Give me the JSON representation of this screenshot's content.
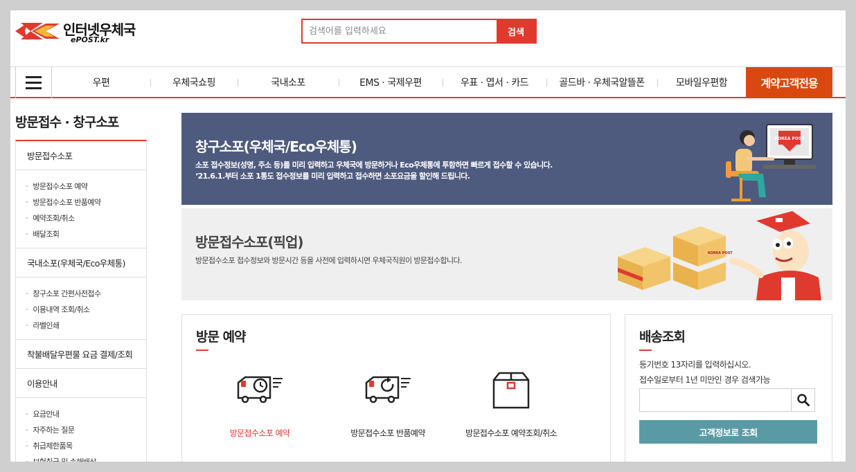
{
  "header": {
    "logo_text": "인터넷우체국",
    "logo_sub": "ePOST.kr",
    "search_placeholder": "검색어를 입력하세요",
    "search_button": "검색"
  },
  "gnb": {
    "items": [
      "우편",
      "우체국쇼핑",
      "국내소포",
      "EMS · 국제우편",
      "우표 · 엽서 · 카드",
      "골드바 · 우체국알뜰폰",
      "모바일우편함"
    ],
    "cta": "계약고객전용"
  },
  "sidebar": {
    "title": "방문접수 · 창구소포",
    "sections": [
      {
        "heading": "방문접수소포",
        "items": [
          "방문접수소포 예약",
          "방문접수소포 반품예약",
          "예약조회/취소",
          "배달조회"
        ]
      },
      {
        "heading": "국내소포(우체국/Eco우체통)",
        "items": [
          "창구소포 간편사전접수",
          "이용내역 조회/취소",
          "라벨인쇄"
        ]
      },
      {
        "heading": "착불배달우편물 요금 결제/조회",
        "items": []
      },
      {
        "heading": "이용안내",
        "items": [
          "요금안내",
          "자주하는 질문",
          "취급제한품목",
          "보험취급 및 손해배상"
        ]
      }
    ]
  },
  "banner1": {
    "title": "창구소포(우체국/Eco우체통)",
    "desc1": "소포 접수정보(성명, 주소 등)를 미리 입력하고 우체국에 방문하거나 Eco우체통에 투함하면 빠르게 접수할 수 있습니다.",
    "desc2": "‘21.6.1.부터 소포 1통도 접수정보를 미리 입력하고 접수하면 소포요금을 할인해 드립니다.",
    "monitor_text": "KOREA POST"
  },
  "banner2": {
    "title": "방문접수소포(픽업)",
    "desc1": "방문접수소포 접수정보와 방문시간 등을 사전에 입력하시면 우체국직원이 방문접수합니다.",
    "box_label": "KOREA POST"
  },
  "visit": {
    "title": "방문 예약",
    "actions": [
      {
        "label": "방문접수소포 예약",
        "icon": "truck-clock-icon",
        "active": true
      },
      {
        "label": "방문접수소포 반품예약",
        "icon": "truck-return-icon",
        "active": false
      },
      {
        "label": "방문접수소포 예약조회/취소",
        "icon": "package-box-icon",
        "active": false
      }
    ]
  },
  "tracking": {
    "title": "배송조회",
    "desc1": "등기번호 13자리를 입력하십시오.",
    "desc2": "접수일로부터 1년 미만인 경우 검색가능",
    "input_placeholder": "",
    "button": "고객정보로 조회"
  },
  "colors": {
    "brand_red": "#e03a2f",
    "cta_orange": "#d9480f",
    "banner_navy": "#4e5b7e",
    "teal_button": "#5a9aa5"
  }
}
